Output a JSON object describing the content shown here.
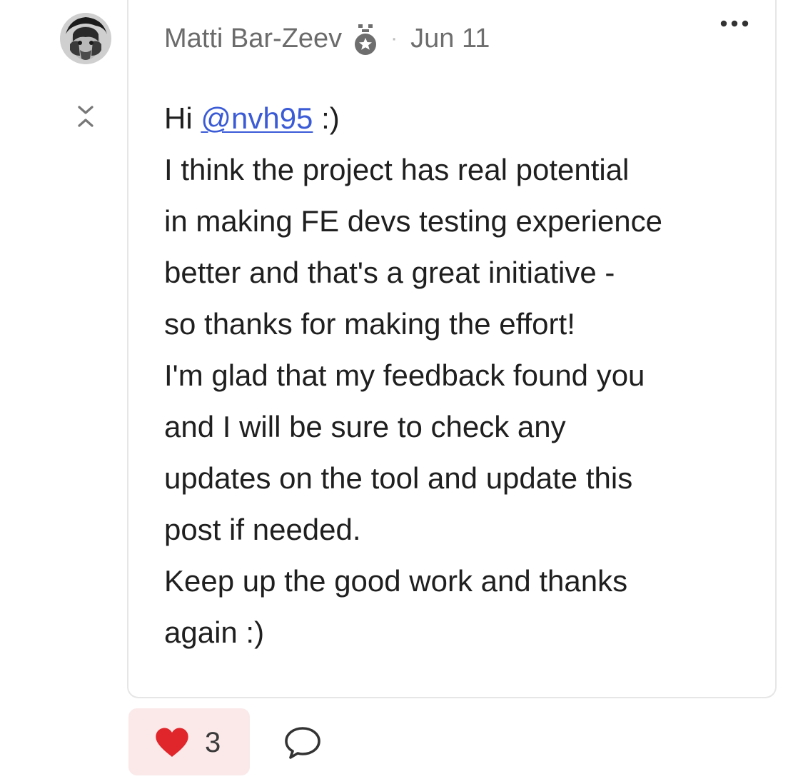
{
  "post": {
    "author": "Matti Bar-Zeev",
    "separator": "·",
    "date": "Jun 11",
    "body": {
      "greeting_prefix": "Hi ",
      "mention": "@nvh95",
      "greeting_suffix": " :)",
      "lines": [
        "I think the project has real potential",
        "in making FE devs testing experience",
        "better and that's a great initiative -",
        "so thanks for making the effort!",
        "I'm glad that my feedback found you",
        "and I will be sure to check any",
        "updates on the tool and update this",
        "post if needed.",
        "Keep up the good work and thanks",
        "again :)"
      ]
    }
  },
  "actions": {
    "like_count": "3",
    "like_color": "#e0252b",
    "like_bg": "#fbe9e9"
  },
  "icons": {
    "avatar": "avatar",
    "badge": "medal-badge-icon",
    "collapse": "collapse-expand-icon",
    "more": "more-options-icon",
    "like": "heart-icon",
    "reply": "speech-bubble-icon"
  }
}
